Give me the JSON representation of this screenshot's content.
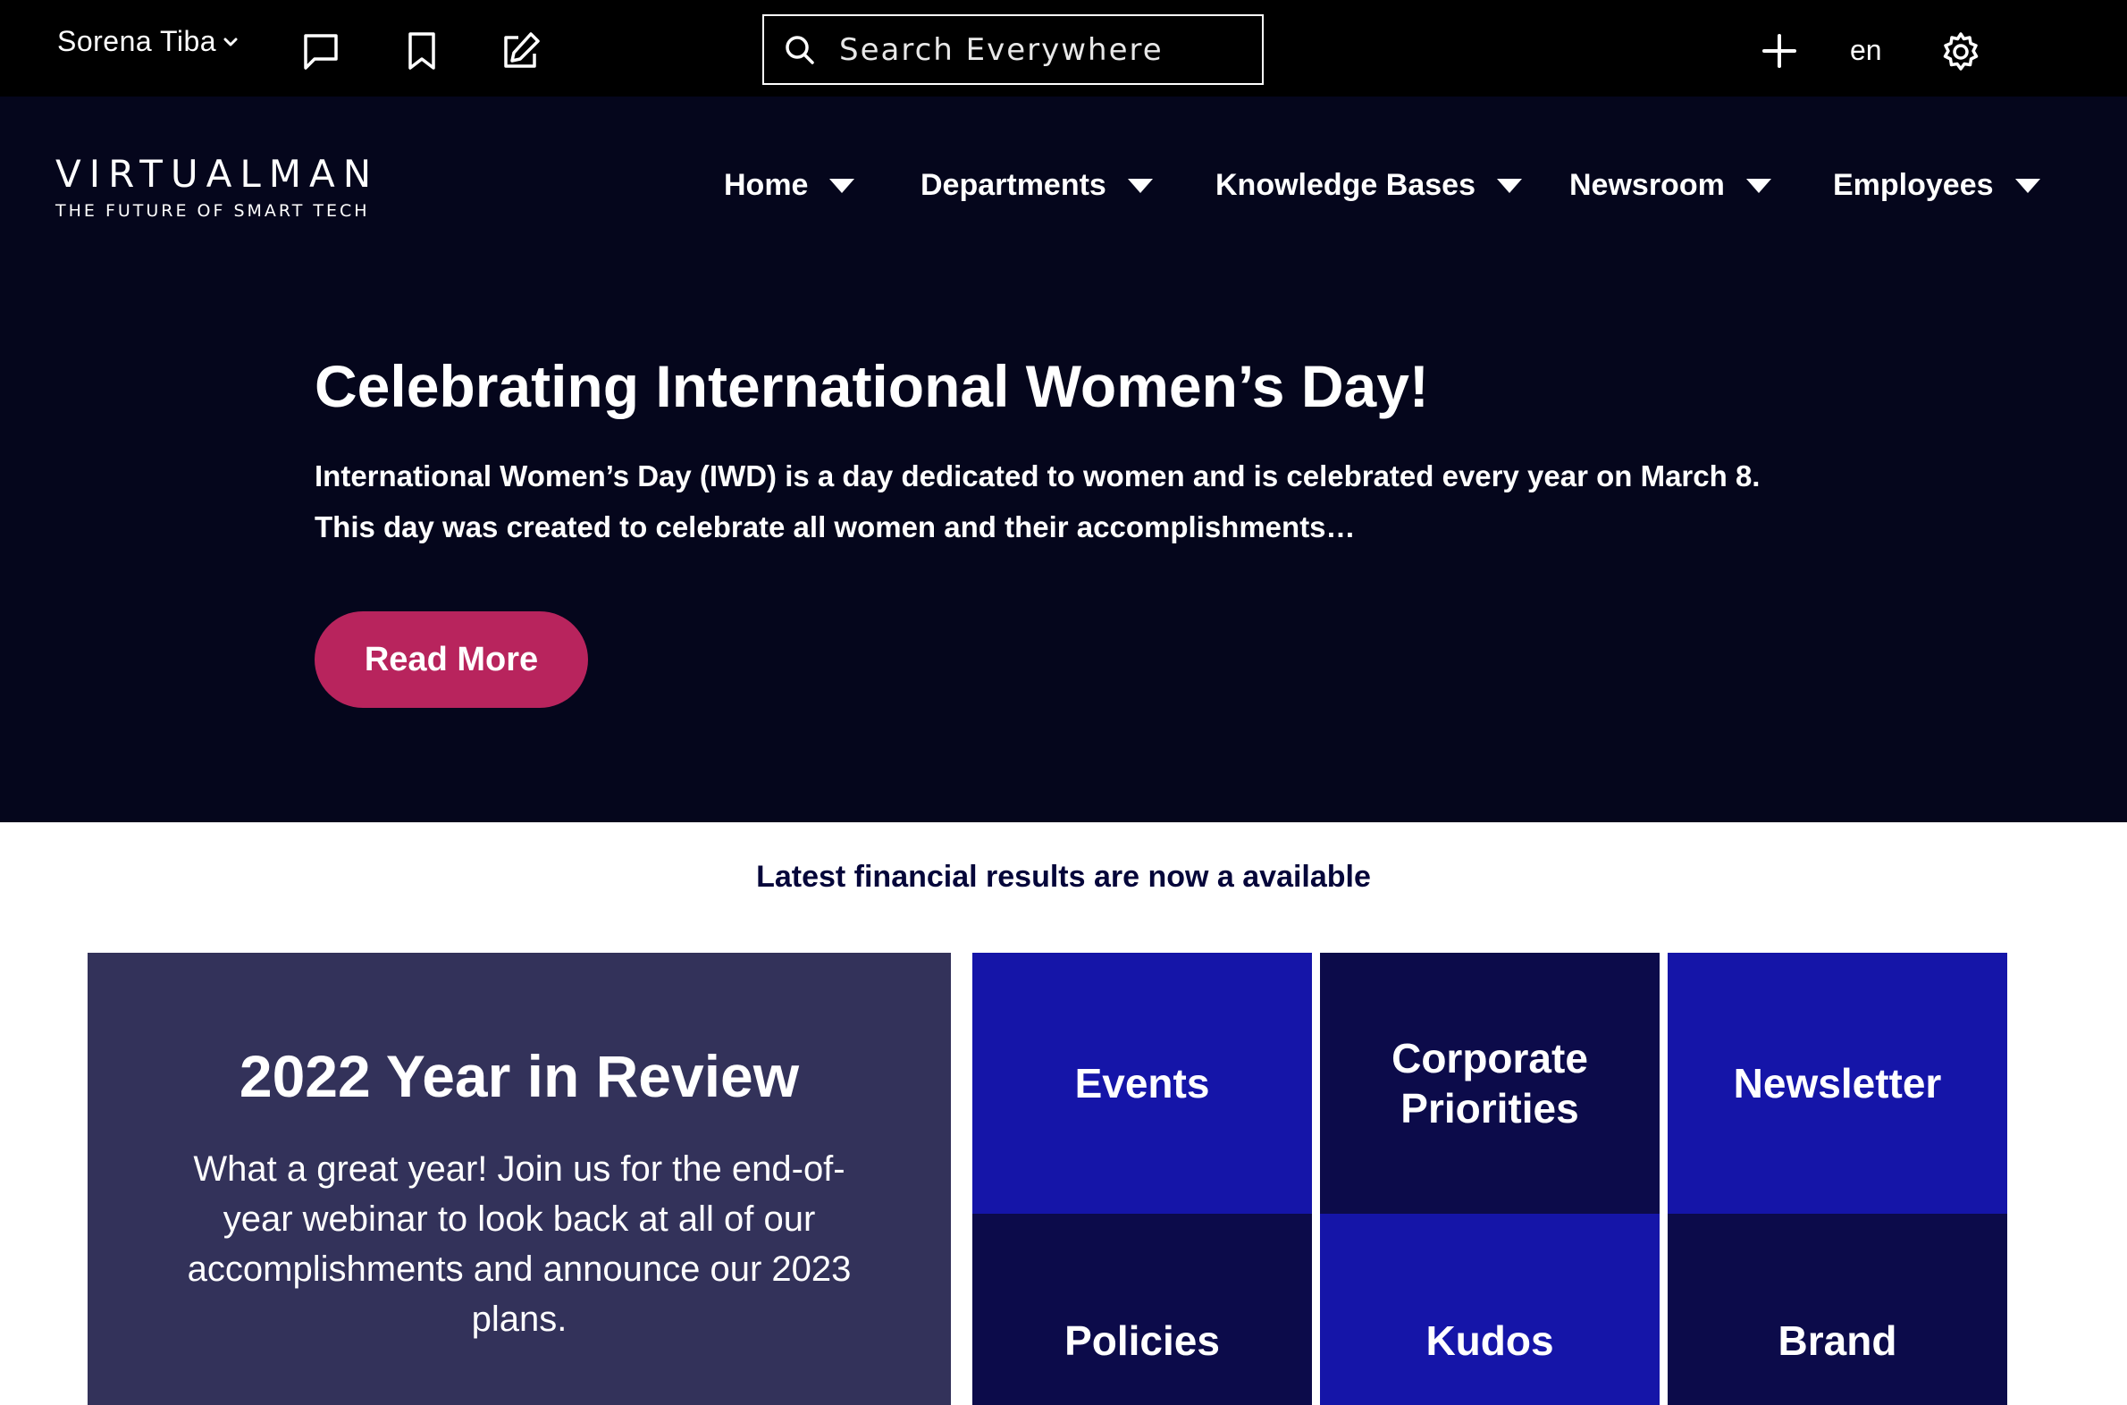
{
  "topbar": {
    "user_name": "Sorena Tiba",
    "icons": [
      "chat-icon",
      "bookmark-icon",
      "edit-icon",
      "search-icon",
      "plus-icon",
      "gear-icon"
    ],
    "search_placeholder": "Search Everywhere",
    "language": "en"
  },
  "brand": {
    "name": "VIRTUALMAN",
    "tagline": "THE FUTURE OF SMART TECH"
  },
  "nav": {
    "items": [
      {
        "label": "Home"
      },
      {
        "label": "Departments"
      },
      {
        "label": "Knowledge Bases"
      },
      {
        "label": "Newsroom"
      },
      {
        "label": "Employees"
      }
    ]
  },
  "hero": {
    "title": "Celebrating International Women’s Day!",
    "text": "International Women’s Day (IWD) is a day dedicated to women and is celebrated every year on March 8. This day was created to celebrate all women and their accomplishments…",
    "button_label": "Read More"
  },
  "announcement": "Latest financial results are now a available",
  "review": {
    "title": "2022 Year in Review",
    "text": "What a great year! Join us for the end-of-year webinar to look back at all of our accomplishments and announce our 2023 plans."
  },
  "tiles": [
    {
      "label": "Events"
    },
    {
      "label": "Corporate Priorities"
    },
    {
      "label": "Newsletter"
    },
    {
      "label": "Policies"
    },
    {
      "label": "Kudos"
    },
    {
      "label": "Brand"
    }
  ],
  "colors": {
    "topbar": "#000000",
    "hero_background": "#05061c",
    "accent_button": "#b8245d",
    "review_card": "#33325a",
    "tile_bright": "#1515a8",
    "tile_dark": "#0c0b4a",
    "announcement_text": "#05063a"
  }
}
